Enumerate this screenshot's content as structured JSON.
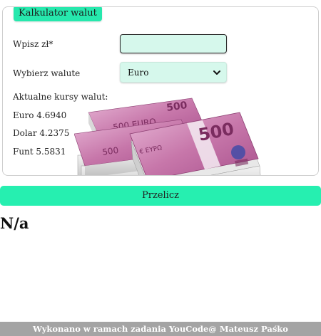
{
  "form": {
    "legend": "Kalkulator walut",
    "amount_label": "Wpisz zł*",
    "amount_value": "",
    "currency_label": "Wybierz walute",
    "currency_selected": "Euro",
    "rates_title": "Aktualne kursy walut:",
    "rates": [
      {
        "text": "Euro 4.6940"
      },
      {
        "text": "Dolar 4.2375"
      },
      {
        "text": "Funt 5.5831"
      }
    ],
    "submit_label": "Przelicz"
  },
  "result": {
    "text": "N/a"
  },
  "footer": {
    "text": "Wykonano w ramach zadania YouCode@ Mateusz Paśko"
  },
  "colors": {
    "accent": "#26efb0",
    "input_bg": "#d6f8ec",
    "footer_bg": "#a4a4a4",
    "banknote_pink": "#c86aa8"
  },
  "icons": {
    "select_arrow": "chevron-down-icon"
  },
  "images": {
    "background": "stack-of-500-euro-banknotes"
  }
}
